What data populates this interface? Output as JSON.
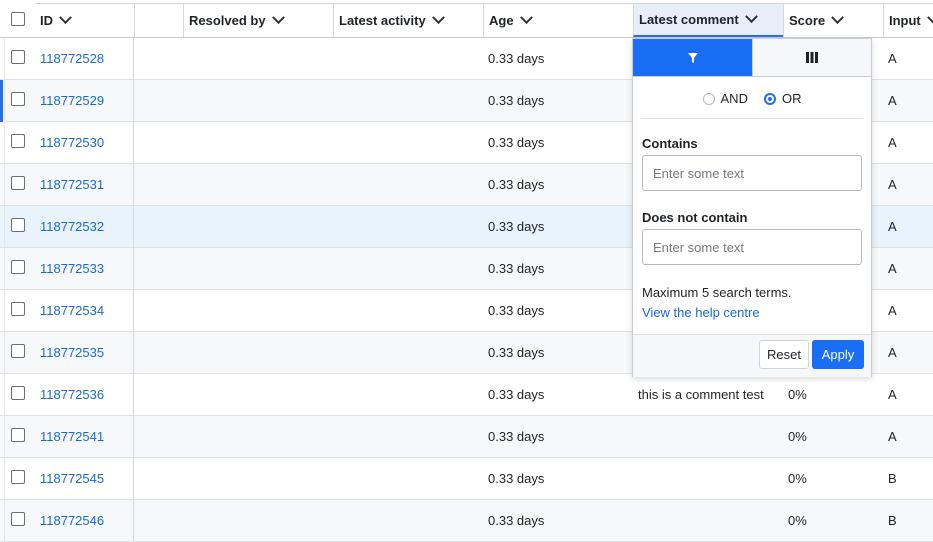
{
  "columns": {
    "id": "ID",
    "resolved_by": "Resolved by",
    "latest_activity": "Latest activity",
    "age": "Age",
    "latest_comment": "Latest comment",
    "score": "Score",
    "input": "Input"
  },
  "rows": [
    {
      "id": "118772528",
      "age": "0.33 days",
      "comment": "",
      "score": "",
      "input": "A"
    },
    {
      "id": "118772529",
      "age": "0.33 days",
      "comment": "",
      "score": "",
      "input": "A"
    },
    {
      "id": "118772530",
      "age": "0.33 days",
      "comment": "",
      "score": "",
      "input": "A"
    },
    {
      "id": "118772531",
      "age": "0.33 days",
      "comment": "",
      "score": "",
      "input": "A"
    },
    {
      "id": "118772532",
      "age": "0.33 days",
      "comment": "",
      "score": "",
      "input": "A"
    },
    {
      "id": "118772533",
      "age": "0.33 days",
      "comment": "",
      "score": "",
      "input": "A"
    },
    {
      "id": "118772534",
      "age": "0.33 days",
      "comment": "",
      "score": "",
      "input": "A"
    },
    {
      "id": "118772535",
      "age": "0.33 days",
      "comment": "",
      "score": "",
      "input": "A"
    },
    {
      "id": "118772536",
      "age": "0.33 days",
      "comment": "this is a comment test",
      "score": "0%",
      "input": "A"
    },
    {
      "id": "118772541",
      "age": "0.33 days",
      "comment": "",
      "score": "0%",
      "input": "A"
    },
    {
      "id": "118772545",
      "age": "0.33 days",
      "comment": "",
      "score": "0%",
      "input": "B"
    },
    {
      "id": "118772546",
      "age": "0.33 days",
      "comment": "",
      "score": "0%",
      "input": "B"
    }
  ],
  "filter_popup": {
    "and_label": "AND",
    "or_label": "OR",
    "selected_mode": "OR",
    "contains_label": "Contains",
    "contains_placeholder": "Enter some text",
    "not_contains_label": "Does not contain",
    "not_contains_placeholder": "Enter some text",
    "note": "Maximum 5 search terms.",
    "help_link": "View the help centre",
    "reset_label": "Reset",
    "apply_label": "Apply",
    "filter_tab_icon": "filter-icon",
    "columns_tab_icon": "columns-icon"
  },
  "colors": {
    "accent": "#1a6ef5",
    "link": "#1a6ad6",
    "highlight_row": "#e8f3fb",
    "active_header": "#e7edf9"
  }
}
